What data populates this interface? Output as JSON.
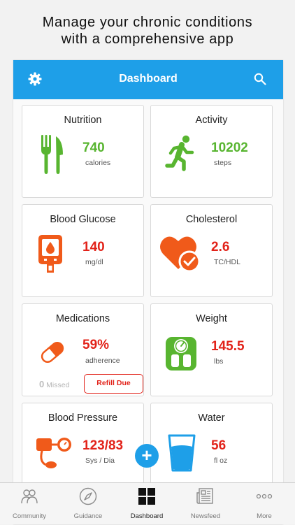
{
  "headline": {
    "line1": "Manage your chronic conditions",
    "line2": "with a comprehensive app"
  },
  "appbar": {
    "title": "Dashboard",
    "settings_icon": "gear-icon",
    "search_icon": "search-icon"
  },
  "colors": {
    "accent": "#1e9fe8",
    "green": "#58b530",
    "red": "#e2231a",
    "orange": "#f05a1a"
  },
  "cards": {
    "nutrition": {
      "title": "Nutrition",
      "value": "740",
      "unit": "calories",
      "icon": "fork-knife-icon"
    },
    "activity": {
      "title": "Activity",
      "value": "10202",
      "unit": "steps",
      "icon": "running-person-icon"
    },
    "glucose": {
      "title": "Blood Glucose",
      "value": "140",
      "unit": "mg/dl",
      "icon": "glucose-meter-icon"
    },
    "cholesterol": {
      "title": "Cholesterol",
      "value": "2.6",
      "unit": "TC/HDL",
      "icon": "heart-check-icon"
    },
    "medications": {
      "title": "Medications",
      "value": "59%",
      "unit": "adherence",
      "icon": "pill-icon",
      "missed_count": "0",
      "missed_label": "Missed",
      "refill_label": "Refill Due"
    },
    "weight": {
      "title": "Weight",
      "value": "145.5",
      "unit": "lbs",
      "icon": "scale-icon"
    },
    "blood_pressure": {
      "title": "Blood Pressure",
      "value": "123/83",
      "unit": "Sys / Dia",
      "icon": "bp-cuff-icon"
    },
    "water": {
      "title": "Water",
      "value": "56",
      "unit": "fl oz",
      "icon": "water-glass-icon"
    }
  },
  "fab": {
    "label": "+"
  },
  "tabs": [
    {
      "label": "Community",
      "icon": "community-icon"
    },
    {
      "label": "Guidance",
      "icon": "compass-icon"
    },
    {
      "label": "Dashboard",
      "icon": "dashboard-icon"
    },
    {
      "label": "Newsfeed",
      "icon": "newspaper-icon"
    },
    {
      "label": "More",
      "icon": "more-icon"
    }
  ]
}
